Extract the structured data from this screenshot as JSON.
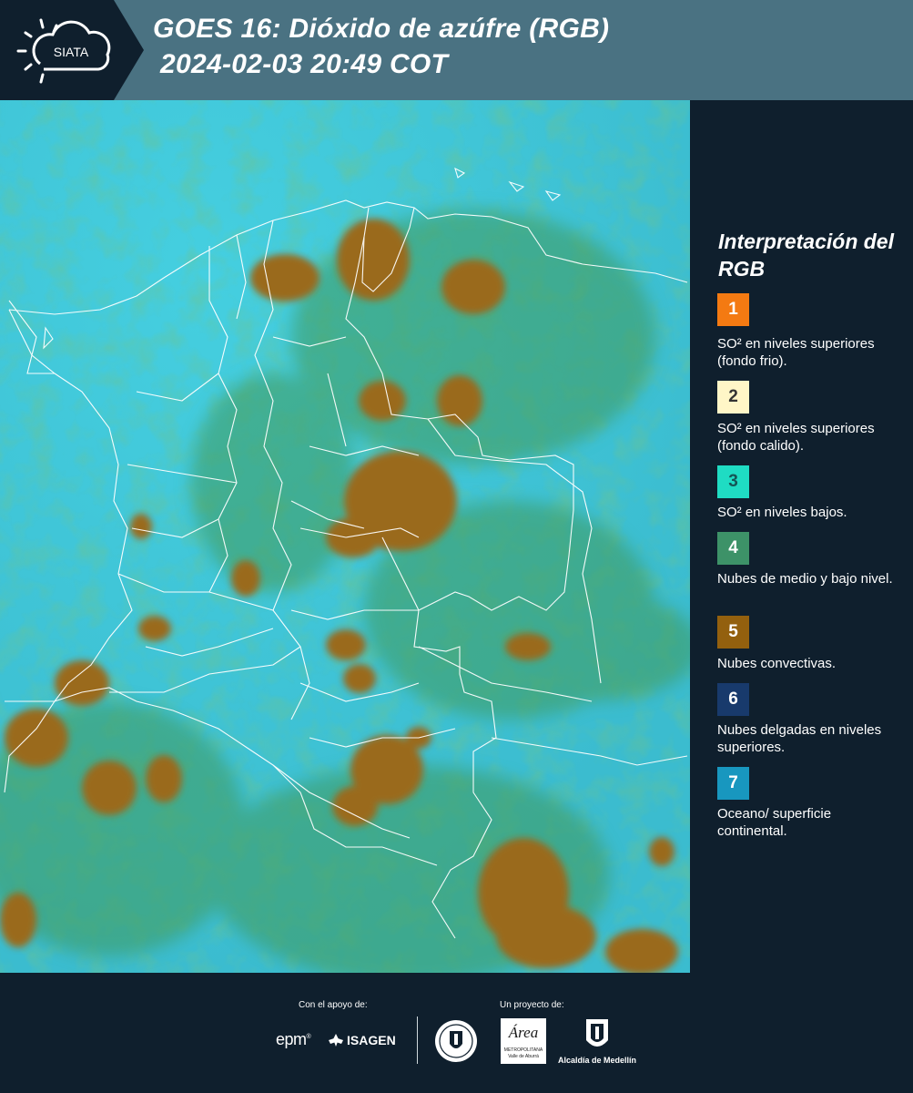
{
  "header": {
    "logo_text": "SIATA",
    "title_line1": "GOES 16: Dióxido de azúfre (RGB)",
    "title_line2": "2024-02-03 20:49 COT",
    "bg_color": "#4a7282",
    "dark_color": "#0f1f2d"
  },
  "map": {
    "icon": "satellite-map-image",
    "base_color": "#3fc3d4"
  },
  "legend": {
    "title": "Interpretación del RGB",
    "items": [
      {
        "number": "1",
        "color": "#f47a12",
        "text_color": "#ffffff",
        "label": "SO² en niveles superiores (fondo frio)."
      },
      {
        "number": "2",
        "color": "#fff6c7",
        "text_color": "#333333",
        "label": "SO² en niveles superiores (fondo calido)."
      },
      {
        "number": "3",
        "color": "#1fdcc3",
        "text_color": "#155555",
        "label": "SO² en niveles bajos."
      },
      {
        "number": "4",
        "color": "#3d9268",
        "text_color": "#ffffff",
        "label": "Nubes de medio y bajo nivel."
      },
      {
        "number": "5",
        "color": "#93600e",
        "text_color": "#ffffff",
        "label": "Nubes convectivas."
      },
      {
        "number": "6",
        "color": "#183a6c",
        "text_color": "#ffffff",
        "label": "Nubes delgadas en niveles superiores."
      },
      {
        "number": "7",
        "color": "#1897bf",
        "text_color": "#ffffff",
        "label": "Oceano/ superficie continental."
      }
    ]
  },
  "footer": {
    "support_label": "Con el apoyo de:",
    "project_label": "Un proyecto de:",
    "logo_epm": "epm",
    "logo_isagen": "ISAGEN",
    "logo_area": "Área",
    "logo_area_sub1": "METROPOLITANA",
    "logo_area_sub2": "Valle de Aburrá",
    "logo_alcaldia": "Alcaldía de Medellín"
  }
}
